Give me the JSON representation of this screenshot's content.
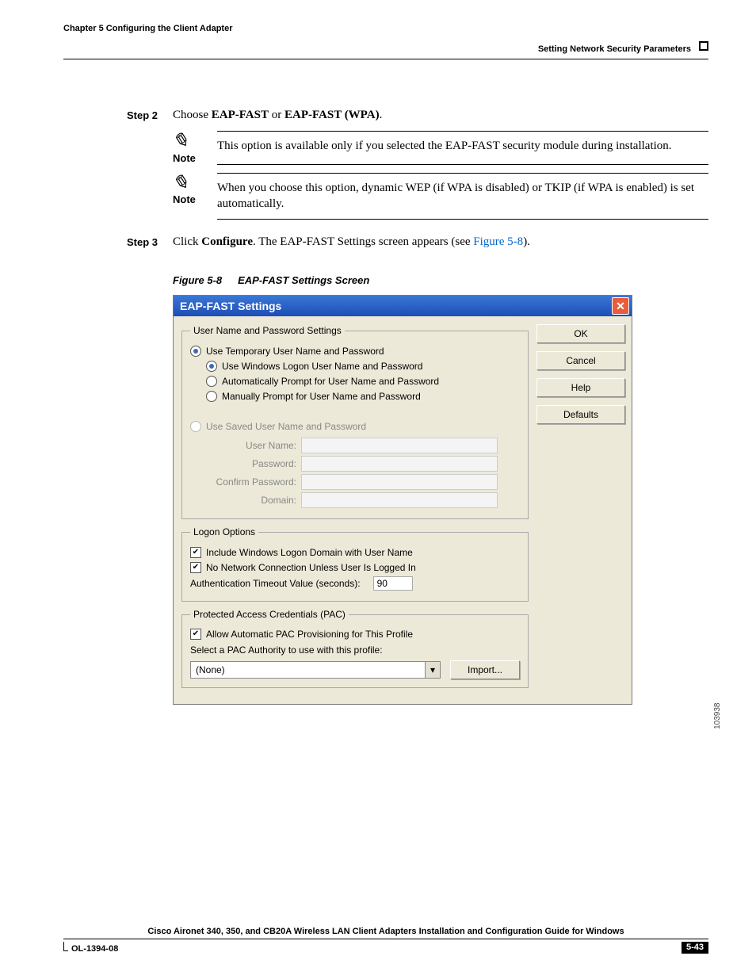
{
  "header": {
    "chapter": "Chapter 5      Configuring the Client Adapter",
    "section": "Setting Network Security Parameters"
  },
  "steps": {
    "s2": {
      "label": "Step 2",
      "prefix": "Choose ",
      "b1": "EAP-FAST",
      "mid": " or ",
      "b2": "EAP-FAST (WPA)",
      "suffix": "."
    },
    "s3": {
      "label": "Step 3",
      "prefix": "Click ",
      "b1": "Configure",
      "mid": ". The EAP-FAST Settings screen appears (see ",
      "link": "Figure 5-8",
      "suffix": ")."
    }
  },
  "notes": {
    "label": "Note",
    "n1": "This option is available only if you selected the EAP-FAST security module during installation.",
    "n2": "When you choose this option, dynamic WEP (if WPA is disabled) or TKIP (if WPA is enabled) is set automatically."
  },
  "figure": {
    "num": "Figure 5-8",
    "title": "EAP-FAST Settings Screen",
    "sidecode": "103938"
  },
  "dialog": {
    "title": "EAP-FAST Settings",
    "buttons": {
      "ok": "OK",
      "cancel": "Cancel",
      "help": "Help",
      "defaults": "Defaults",
      "import": "Import..."
    },
    "group1": {
      "legend": "User Name and Password Settings",
      "r1": "Use Temporary User Name and Password",
      "r1a": "Use Windows Logon User Name and Password",
      "r1b": "Automatically Prompt for User Name and Password",
      "r1c": "Manually Prompt for User Name and Password",
      "r2": "Use Saved User Name and Password",
      "f_user": "User Name:",
      "f_pass": "Password:",
      "f_conf": "Confirm Password:",
      "f_dom": "Domain:"
    },
    "group2": {
      "legend": "Logon Options",
      "c1": "Include Windows Logon Domain with User Name",
      "c2": "No Network Connection Unless User Is Logged In",
      "timeout_lbl": "Authentication Timeout Value (seconds):",
      "timeout_val": "90"
    },
    "group3": {
      "legend": "Protected Access Credentials (PAC)",
      "c1": "Allow Automatic PAC Provisioning for This Profile",
      "sel_lbl": "Select a PAC Authority to use with this profile:",
      "sel_val": "(None)"
    }
  },
  "footer": {
    "guide": "Cisco Aironet 340, 350, and CB20A Wireless LAN Client Adapters Installation and Configuration Guide for Windows",
    "ol": "OL-1394-08",
    "page": "5-43"
  }
}
